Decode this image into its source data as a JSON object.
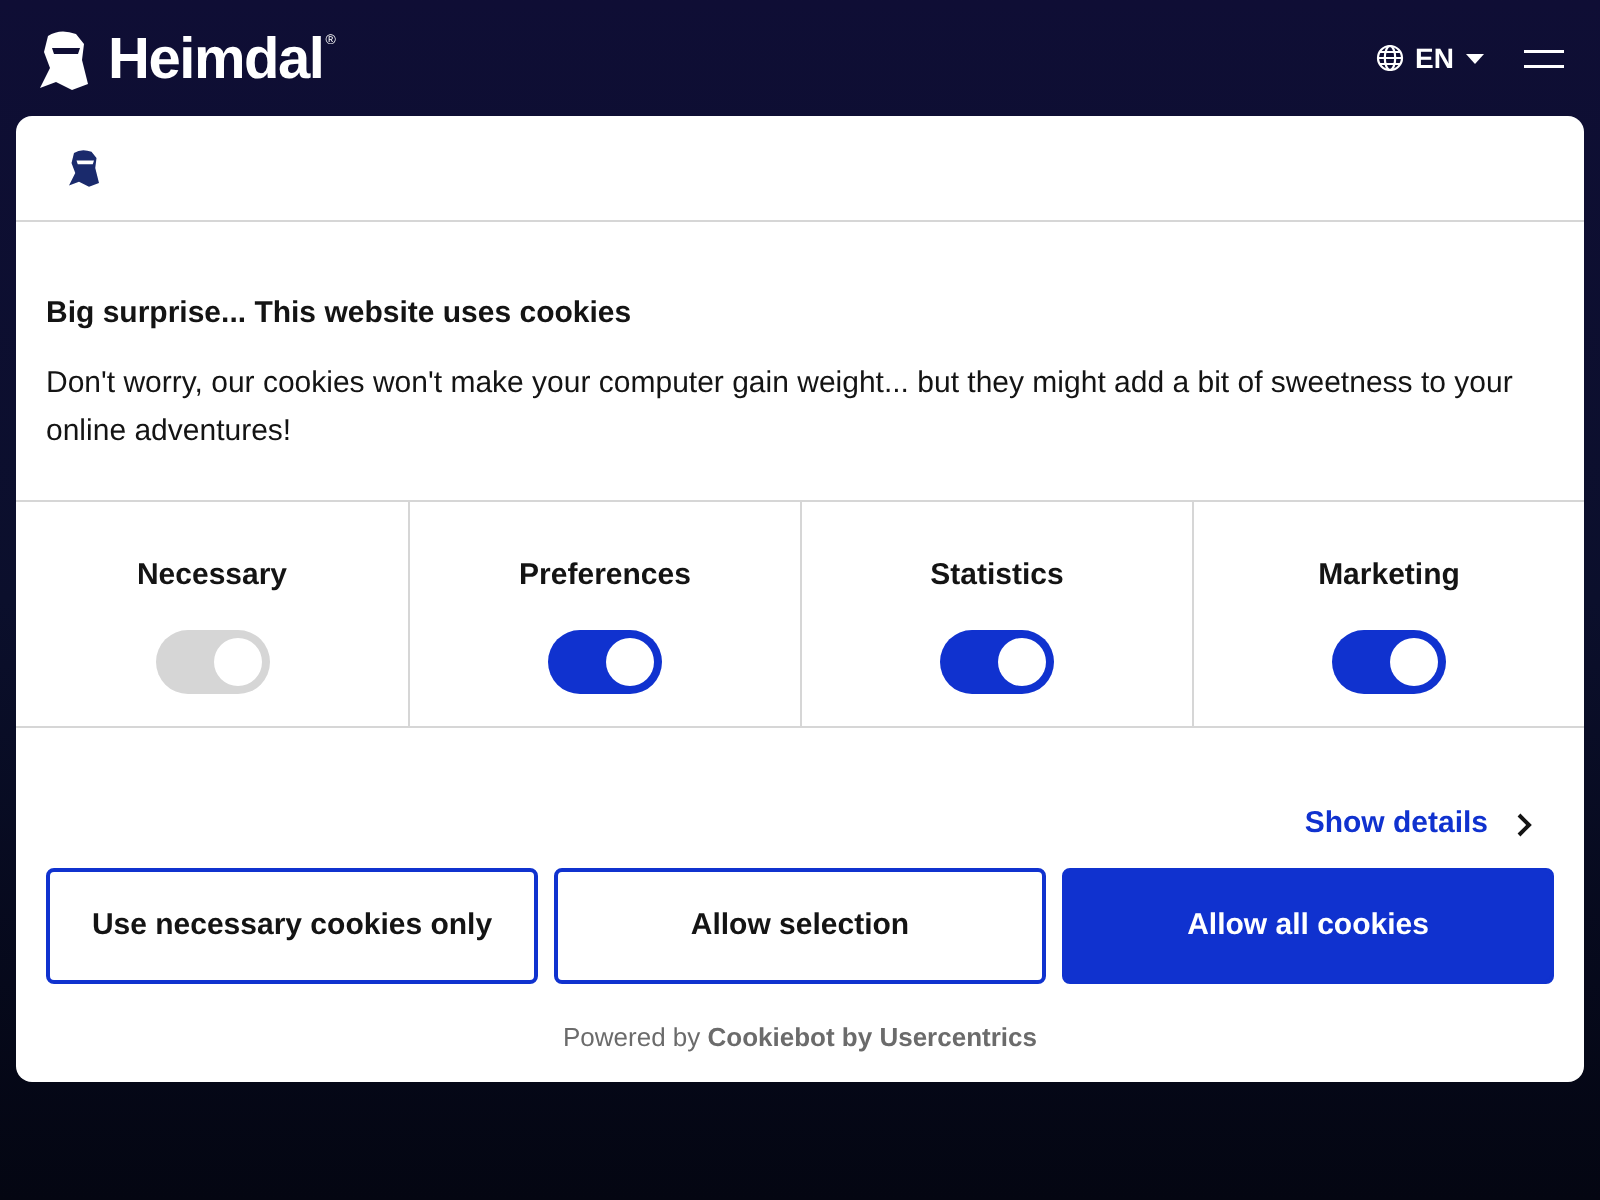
{
  "header": {
    "brand": "Heimdal",
    "registered": "®",
    "language": "EN"
  },
  "dialog": {
    "title": "Big surprise... This website uses cookies",
    "body": "Don't worry, our cookies won't make your computer gain weight... but they might add a bit of sweetness to your online adventures!",
    "categories": [
      {
        "label": "Necessary",
        "checked": true,
        "disabled": true
      },
      {
        "label": "Preferences",
        "checked": true,
        "disabled": false
      },
      {
        "label": "Statistics",
        "checked": true,
        "disabled": false
      },
      {
        "label": "Marketing",
        "checked": true,
        "disabled": false
      }
    ],
    "details_link": "Show details",
    "buttons": [
      {
        "label": "Use necessary cookies only",
        "kind": "outline"
      },
      {
        "label": "Allow selection",
        "kind": "outline"
      },
      {
        "label": "Allow all cookies",
        "kind": "primary"
      }
    ],
    "footer": "Powered by **Cookiebot by Usercentrics**"
  }
}
